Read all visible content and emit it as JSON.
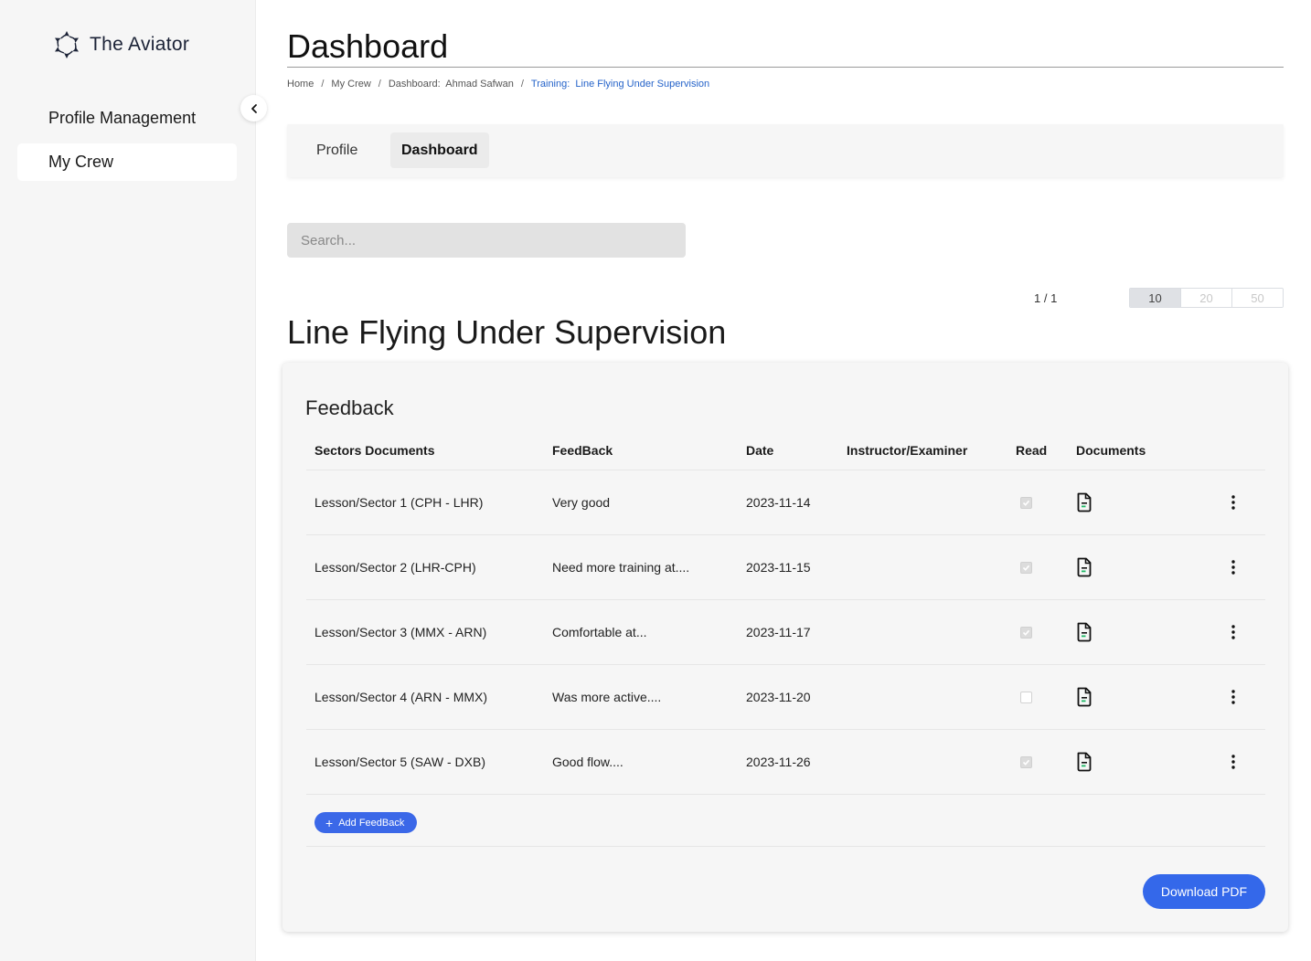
{
  "app": {
    "brand": "The Aviator"
  },
  "sidebar": {
    "items": [
      {
        "label": "Profile Management",
        "active": false
      },
      {
        "label": "My Crew",
        "active": true
      }
    ]
  },
  "header": {
    "title": "Dashboard",
    "breadcrumb": [
      {
        "label": "Home"
      },
      {
        "label": "My Crew"
      },
      {
        "label": "Dashboard:  Ahmad Safwan"
      },
      {
        "label": "Training:  Line Flying Under Supervision",
        "current": true
      }
    ]
  },
  "tabs": [
    {
      "label": "Profile",
      "active": false
    },
    {
      "label": "Dashboard",
      "active": true
    }
  ],
  "search": {
    "placeholder": "Search...",
    "value": ""
  },
  "pagination": {
    "page_info": "1 / 1",
    "page_sizes": [
      "10",
      "20",
      "50"
    ],
    "selected_page_size": "10"
  },
  "section": {
    "title": "Line Flying Under Supervision"
  },
  "feedback": {
    "title": "Feedback",
    "columns": [
      "Sectors Documents",
      "FeedBack",
      "Date",
      "Instructor/Examiner",
      "Read",
      "Documents"
    ],
    "rows": [
      {
        "sector": "Lesson/Sector 1 (CPH - LHR)",
        "feedback": "Very good",
        "date": "2023-11-14",
        "instructor": "",
        "read": true,
        "document_icon": "document-icon"
      },
      {
        "sector": "Lesson/Sector 2 (LHR-CPH)",
        "feedback": "Need more training at....",
        "date": "2023-11-15",
        "instructor": "",
        "read": true,
        "document_icon": "document-icon"
      },
      {
        "sector": "Lesson/Sector 3 (MMX - ARN)",
        "feedback": "Comfortable at...",
        "date": "2023-11-17",
        "instructor": "",
        "read": true,
        "document_icon": "document-icon"
      },
      {
        "sector": "Lesson/Sector 4 (ARN - MMX)",
        "feedback": "Was more active....",
        "date": "2023-11-20",
        "instructor": "",
        "read": false,
        "document_icon": "document-icon"
      },
      {
        "sector": "Lesson/Sector 5 (SAW - DXB)",
        "feedback": "Good flow....",
        "date": "2023-11-26",
        "instructor": "",
        "read": true,
        "document_icon": "document-icon"
      }
    ],
    "add_button": "Add FeedBack",
    "download_button": "Download PDF"
  },
  "colors": {
    "primary": "#3468ea",
    "breadcrumb_current": "#2563c9",
    "sidebar_bg": "#f6f6f6",
    "doc_icon_accent": "#1fb866"
  }
}
